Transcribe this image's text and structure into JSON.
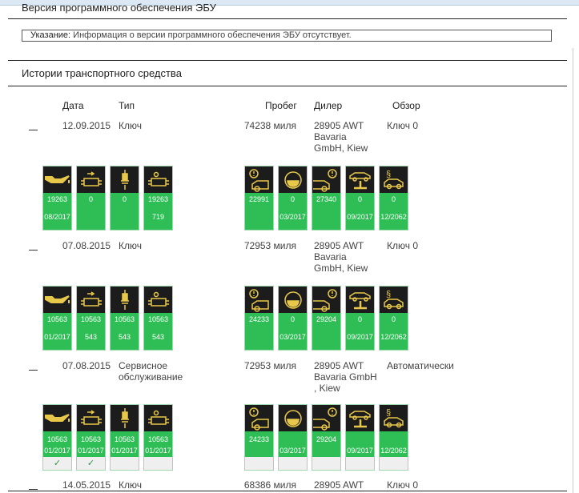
{
  "ecu_section": {
    "title": "Версия программного обеспечения ЭБУ",
    "note_label": "Указание:",
    "note_text": " Информация о версии программного обеспечения ЭБУ отсутствует."
  },
  "history": {
    "title": "Истории транспортного средства",
    "headers": {
      "date": "Дата",
      "type": "Тип",
      "mileage": "Пробег",
      "dealer": "Дилер",
      "overview": "Обзор"
    },
    "entries": [
      {
        "date": "12.09.2015",
        "type": "Ключ",
        "mileage": "74238 миля",
        "dealer": "28905 AWT Bavaria GmbH, Kiew",
        "overview": "Ключ 0",
        "left": [
          {
            "icon": "engine-oil-icon",
            "v1": "19263",
            "v2": "08/2017"
          },
          {
            "icon": "air-filter-icon",
            "v1": "0",
            "v2": ""
          },
          {
            "icon": "spark-plug-icon",
            "v1": "0",
            "v2": ""
          },
          {
            "icon": "microfilter-icon",
            "v1": "19263",
            "v2": "719"
          }
        ],
        "right": [
          {
            "icon": "front-brakes-icon",
            "v1": "22991",
            "v2": ""
          },
          {
            "icon": "brake-fluid-icon",
            "v1": "0",
            "v2": "03/2017"
          },
          {
            "icon": "rear-brakes-icon",
            "v1": "27340",
            "v2": ""
          },
          {
            "icon": "vehicle-check-icon",
            "v1": "0",
            "v2": "09/2017"
          },
          {
            "icon": "statutory-inspection-icon",
            "v1": "0",
            "v2": "12/2062"
          }
        ]
      },
      {
        "date": "07.08.2015",
        "type": "Ключ",
        "mileage": "72953 миля",
        "dealer": "28905 AWT Bavaria GmbH, Kiew",
        "overview": "Ключ 0",
        "left": [
          {
            "icon": "engine-oil-icon",
            "v1": "10563",
            "v2": "01/2017"
          },
          {
            "icon": "air-filter-icon",
            "v1": "10563",
            "v2": "543"
          },
          {
            "icon": "spark-plug-icon",
            "v1": "10563",
            "v2": "543"
          },
          {
            "icon": "microfilter-icon",
            "v1": "10563",
            "v2": "543"
          }
        ],
        "right": [
          {
            "icon": "front-brakes-icon",
            "v1": "24233",
            "v2": ""
          },
          {
            "icon": "brake-fluid-icon",
            "v1": "0",
            "v2": "03/2017"
          },
          {
            "icon": "rear-brakes-icon",
            "v1": "29204",
            "v2": ""
          },
          {
            "icon": "vehicle-check-icon",
            "v1": "0",
            "v2": "09/2017"
          },
          {
            "icon": "statutory-inspection-icon",
            "v1": "0",
            "v2": "12/2062"
          }
        ]
      },
      {
        "date": "07.08.2015",
        "type": "Сервисное обслуживание",
        "mileage": "72953 миля",
        "dealer": "28905 AWT Bavaria GmbH , Kiew",
        "overview": "Автоматически",
        "check": true,
        "left": [
          {
            "icon": "engine-oil-icon",
            "v1": "10563",
            "v2": "01/2017",
            "done": "✓"
          },
          {
            "icon": "air-filter-icon",
            "v1": "10563",
            "v2": "01/2017",
            "done": "✓"
          },
          {
            "icon": "spark-plug-icon",
            "v1": "10563",
            "v2": "01/2017",
            "done": ""
          },
          {
            "icon": "microfilter-icon",
            "v1": "10563",
            "v2": "01/2017",
            "done": ""
          }
        ],
        "right": [
          {
            "icon": "front-brakes-icon",
            "v1": "24233",
            "v2": "",
            "done": ""
          },
          {
            "icon": "brake-fluid-icon",
            "v1": "",
            "v2": "03/2017",
            "done": ""
          },
          {
            "icon": "rear-brakes-icon",
            "v1": "29204",
            "v2": "",
            "done": ""
          },
          {
            "icon": "vehicle-check-icon",
            "v1": "",
            "v2": "09/2017",
            "done": ""
          },
          {
            "icon": "statutory-inspection-icon",
            "v1": "",
            "v2": "12/2062",
            "done": ""
          }
        ]
      },
      {
        "date": "14.05.2015",
        "type": "Ключ",
        "mileage": "68386 миля",
        "dealer": "28905 AWT",
        "overview": "Ключ 0",
        "left": [],
        "right": []
      }
    ]
  },
  "colors": {
    "tile_green": "#2fbe55",
    "icon_yellow": "#e8c84a"
  }
}
